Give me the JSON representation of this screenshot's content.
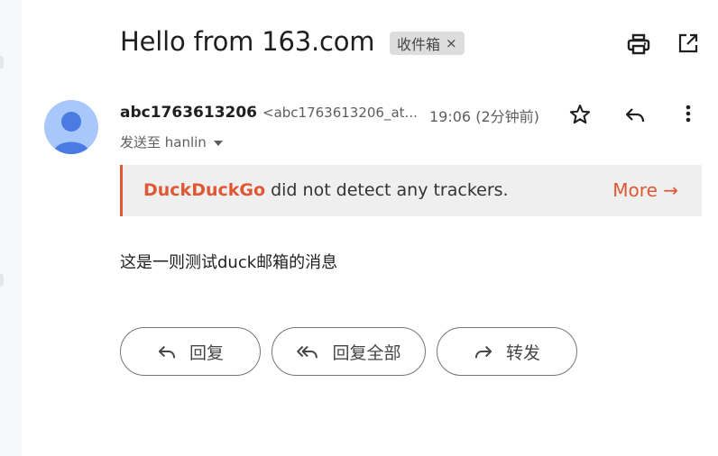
{
  "header": {
    "subject": "Hello from 163.com",
    "label": "收件箱",
    "label_remove": "×"
  },
  "message": {
    "sender_name": "abc1763613206",
    "sender_email": "<abc1763613206_at...",
    "time": "19:06 (2分钟前)",
    "recipient_line": "发送至 hanlin",
    "body": "这是一则测试duck邮箱的消息"
  },
  "tracker_banner": {
    "brand": "DuckDuckGo",
    "text": " did not detect any trackers.",
    "more": "More →",
    "accent_color": "#de5833"
  },
  "actions": {
    "reply": "回复",
    "reply_all": "回复全部",
    "forward": "转发"
  },
  "icons": [
    "print-icon",
    "open-in-new-icon",
    "star-icon",
    "reply-icon",
    "more-vert-icon",
    "caret-down-icon",
    "avatar-person-icon",
    "reply-all-icon",
    "forward-icon"
  ]
}
